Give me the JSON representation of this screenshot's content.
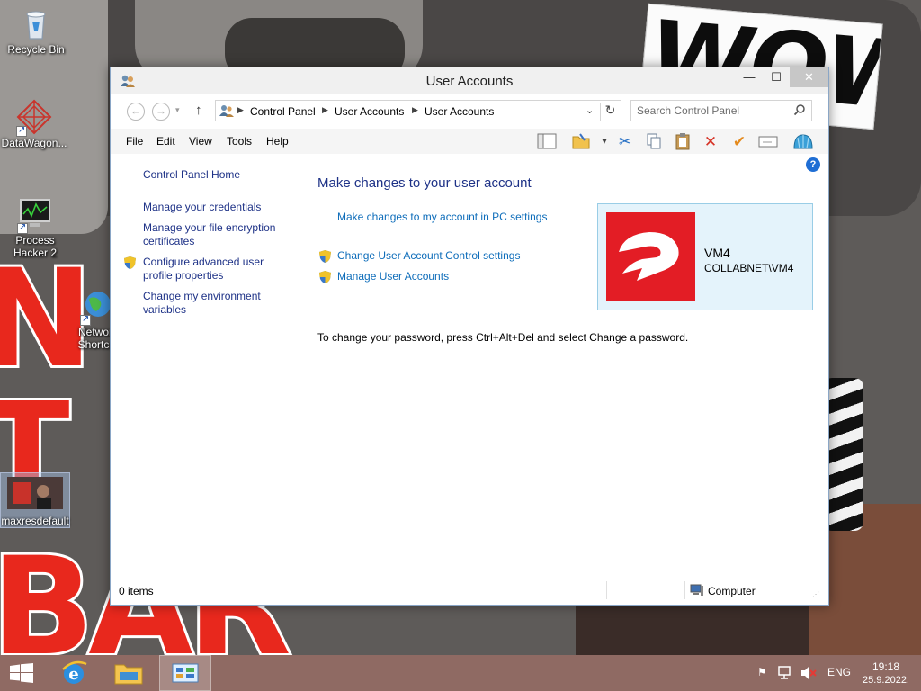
{
  "desktop": {
    "icons": [
      {
        "label": "Recycle Bin"
      },
      {
        "label": "DataWagon..."
      },
      {
        "label": "Process Hacker 2"
      },
      {
        "label": "Network Shortc..."
      },
      {
        "label": "maxresdefault"
      }
    ],
    "wallpaper_text": {
      "word": "WOW",
      "letters_n": "N",
      "letters_t": "T",
      "bar": "BAR"
    }
  },
  "window": {
    "title": "User Accounts",
    "controls": {
      "minimize": "—",
      "maximize": "☐",
      "close": "✕"
    },
    "breadcrumb": [
      "Control Panel",
      "User Accounts",
      "User Accounts"
    ],
    "search_placeholder": "Search Control Panel",
    "menu": [
      "File",
      "Edit",
      "View",
      "Tools",
      "Help"
    ],
    "left_pane": {
      "home": "Control Panel Home",
      "links": [
        "Manage your credentials",
        "Manage your file encryption certificates",
        "Configure advanced user profile properties",
        "Change my environment variables"
      ]
    },
    "content": {
      "title": "Make changes to your user account",
      "pc_settings_link": "Make changes to my account in PC settings",
      "uac_link": "Change User Account Control settings",
      "manage_link": "Manage User Accounts",
      "password_note": "To change your password, press Ctrl+Alt+Del and select Change a password."
    },
    "user": {
      "name": "VM4",
      "domain": "COLLABNET\\VM4",
      "accent": "#e31d25"
    },
    "status": {
      "items": "0 items",
      "location": "Computer"
    }
  },
  "taskbar": {
    "tray": {
      "language": "ENG"
    },
    "clock": {
      "time": "19:18",
      "date": "25.9.2022."
    }
  },
  "colors": {
    "link": "#0e6dba",
    "heading": "#1e3287",
    "taskbar": "#8f6a63",
    "tile_bg": "#e4f3fb"
  }
}
